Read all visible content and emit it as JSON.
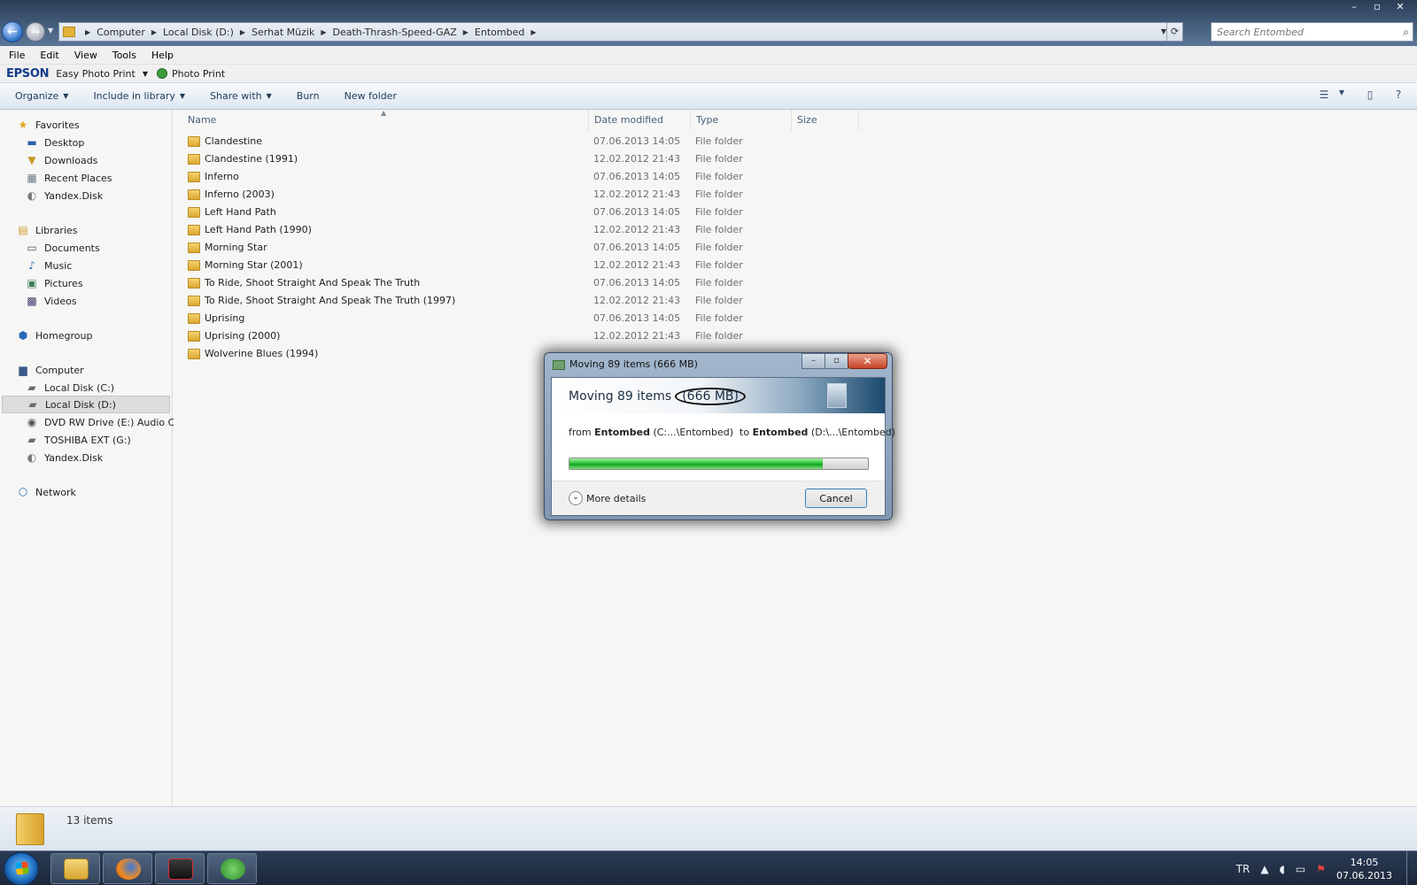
{
  "window_controls": {
    "minimize": "–",
    "maximize": "▫",
    "close": "✕"
  },
  "breadcrumb": [
    "Computer",
    "Local Disk (D:)",
    "Serhat Müzik",
    "Death-Thrash-Speed-GAZ",
    "Entombed"
  ],
  "search": {
    "placeholder": "Search Entombed"
  },
  "menubar": [
    "File",
    "Edit",
    "View",
    "Tools",
    "Help"
  ],
  "epson": {
    "logo": "EPSON",
    "app": "Easy Photo Print",
    "photo_print": "Photo Print"
  },
  "commandbar": {
    "organize": "Organize",
    "include_in_library": "Include in library",
    "share_with": "Share with",
    "burn": "Burn",
    "new_folder": "New folder"
  },
  "sidebar": {
    "favorites": "Favorites",
    "favorites_items": [
      "Desktop",
      "Downloads",
      "Recent Places",
      "Yandex.Disk"
    ],
    "libraries": "Libraries",
    "libraries_items": [
      "Documents",
      "Music",
      "Pictures",
      "Videos"
    ],
    "homegroup": "Homegroup",
    "computer": "Computer",
    "computer_items": [
      "Local Disk (C:)",
      "Local Disk (D:)",
      "DVD RW Drive (E:) Audio CD",
      "TOSHIBA EXT (G:)",
      "Yandex.Disk"
    ],
    "network": "Network"
  },
  "columns": {
    "name": "Name",
    "date": "Date modified",
    "type": "Type",
    "size": "Size"
  },
  "files": [
    {
      "name": "Clandestine",
      "date": "07.06.2013 14:05",
      "type": "File folder"
    },
    {
      "name": "Clandestine (1991)",
      "date": "12.02.2012 21:43",
      "type": "File folder"
    },
    {
      "name": "Inferno",
      "date": "07.06.2013 14:05",
      "type": "File folder"
    },
    {
      "name": "Inferno (2003)",
      "date": "12.02.2012 21:43",
      "type": "File folder"
    },
    {
      "name": "Left Hand Path",
      "date": "07.06.2013 14:05",
      "type": "File folder"
    },
    {
      "name": "Left Hand Path (1990)",
      "date": "12.02.2012 21:43",
      "type": "File folder"
    },
    {
      "name": "Morning Star",
      "date": "07.06.2013 14:05",
      "type": "File folder"
    },
    {
      "name": "Morning Star (2001)",
      "date": "12.02.2012 21:43",
      "type": "File folder"
    },
    {
      "name": "To Ride, Shoot Straight And Speak The Truth",
      "date": "07.06.2013 14:05",
      "type": "File folder"
    },
    {
      "name": "To Ride, Shoot Straight And Speak The Truth (1997)",
      "date": "12.02.2012 21:43",
      "type": "File folder"
    },
    {
      "name": "Uprising",
      "date": "07.06.2013 14:05",
      "type": "File folder"
    },
    {
      "name": "Uprising (2000)",
      "date": "12.02.2012 21:43",
      "type": "File folder"
    },
    {
      "name": "Wolverine Blues (1994)",
      "date": "",
      "type": ""
    }
  ],
  "status": {
    "count": "13 items"
  },
  "dialog": {
    "title": "Moving 89 items (666 MB)",
    "heading_prefix": "Moving 89 items",
    "heading_size": "(666 MB)",
    "from_label": "from",
    "from_name": "Entombed",
    "from_path": "(C:...\\Entombed)",
    "to_label": "to",
    "to_name": "Entombed",
    "to_path": "(D:\\...\\Entombed)",
    "progress_fraction": 0.85,
    "more_details": "More details",
    "cancel": "Cancel"
  },
  "tray": {
    "language": "TR",
    "time": "14:05",
    "date": "07.06.2013"
  },
  "colors": {
    "accent": "#1e3a5a",
    "progress": "#2fc43a",
    "taskbar": "#1c2839"
  }
}
